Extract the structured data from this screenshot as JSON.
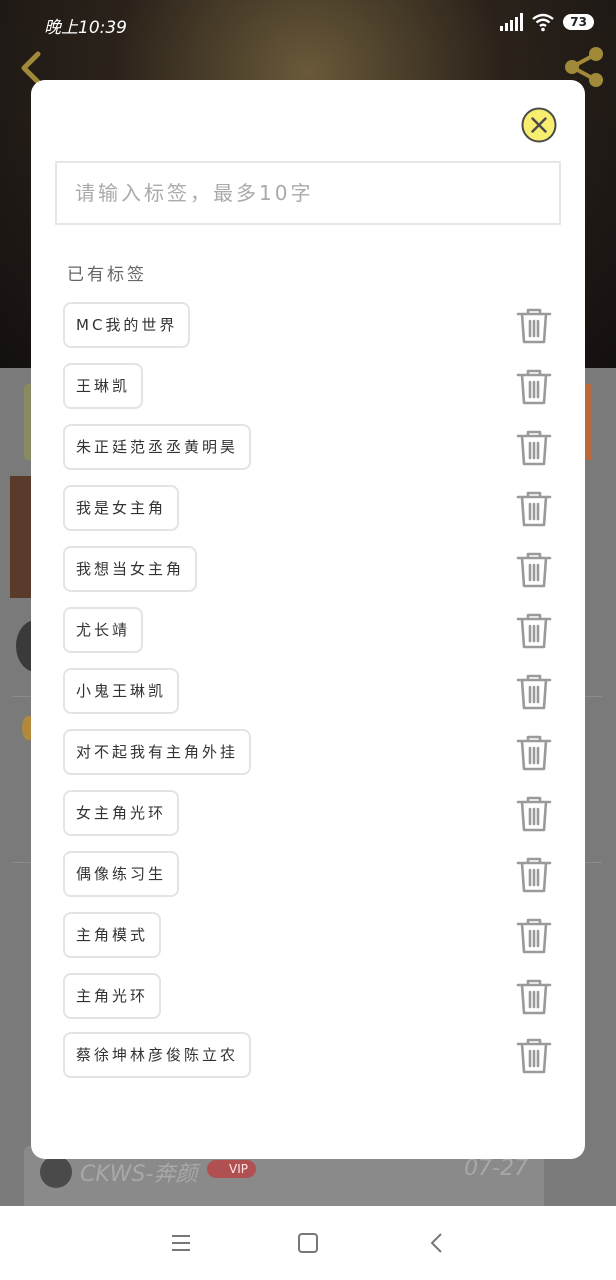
{
  "status_bar": {
    "time": "晚上10:39",
    "battery": "73"
  },
  "background": {
    "comment": {
      "username": "CKWS-奔颜",
      "badge": "VIP",
      "date": "07-27"
    }
  },
  "modal": {
    "input": {
      "value": "",
      "placeholder": "请输入标签，最多10字"
    },
    "section_title": "已有标签",
    "tags": [
      "MC我的世界",
      "王琳凯",
      "朱正廷范丞丞黄明昊",
      "我是女主角",
      "我想当女主角",
      "尤长靖",
      "小鬼王琳凯",
      "对不起我有主角外挂",
      "女主角光环",
      "偶像练习生",
      "主角模式",
      "主角光环",
      "蔡徐坤林彦俊陈立农"
    ]
  },
  "icons": {
    "close": "close-circle-icon",
    "delete": "trash-icon",
    "back": "back-arrow-icon",
    "share": "share-icon"
  },
  "colors": {
    "close_fill": "#f7ed6e",
    "icon_gray": "#9a9a9a",
    "chip_border": "#e4e4e4"
  }
}
